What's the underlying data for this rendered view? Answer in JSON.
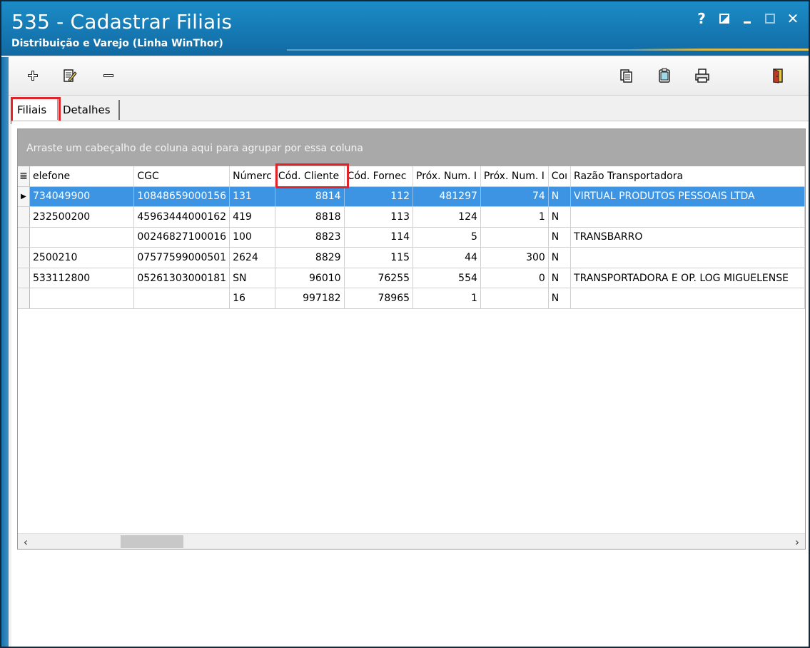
{
  "window": {
    "title": "535 - Cadastrar Filiais",
    "subtitle": "Distribuição e Varejo (Linha WinThor)",
    "controls": {
      "help": "?",
      "minimize": "",
      "maximize": "",
      "close": "✕"
    }
  },
  "toolbar": {
    "buttons": [
      "add-icon",
      "edit-icon",
      "remove-icon",
      "copy-icon",
      "notes-icon",
      "print-icon",
      "exit-icon"
    ]
  },
  "tabs": [
    {
      "label": "Filiais",
      "active": true
    },
    {
      "label": "Detalhes",
      "active": false
    }
  ],
  "grid": {
    "group_hint": "Arraste um cabeçalho de coluna aqui para agrupar por essa coluna",
    "columns": [
      "elefone",
      "CGC",
      "Númerc",
      "Cód. Cliente",
      "Cód. Fornec",
      "Próx. Num. I",
      "Próx. Num. I",
      "Coı",
      "Razão Transportadora"
    ],
    "rows": [
      [
        "734049900",
        "10848659000156",
        "131",
        "8814",
        "112",
        "481297",
        "74",
        "N",
        "VIRTUAL PRODUTOS PESSOAIS LTDA"
      ],
      [
        "232500200",
        "45963444000162",
        "419",
        "8818",
        "113",
        "124",
        "1",
        "N",
        ""
      ],
      [
        "",
        "00246827100016",
        "100",
        "8823",
        "114",
        "5",
        "",
        "N",
        "TRANSBARRO"
      ],
      [
        "2500210",
        "07577599000501",
        "2624",
        "8829",
        "115",
        "44",
        "300",
        "N",
        ""
      ],
      [
        "533112800",
        "05261303000181",
        "SN",
        "96010",
        "76255",
        "554",
        "0",
        "N",
        "TRANSPORTADORA E OP. LOG MIGUELENSE"
      ],
      [
        "",
        "",
        "16",
        "997182",
        "78965",
        "1",
        "",
        "N",
        ""
      ]
    ],
    "selected_row": 0,
    "scroll": {
      "left_arrow": "‹",
      "right_arrow": "›"
    }
  },
  "colors": {
    "titlebar": "#1679b3",
    "selection": "#3d94e2",
    "highlight": "#e0242c",
    "groupbar": "#a9a9a9"
  }
}
